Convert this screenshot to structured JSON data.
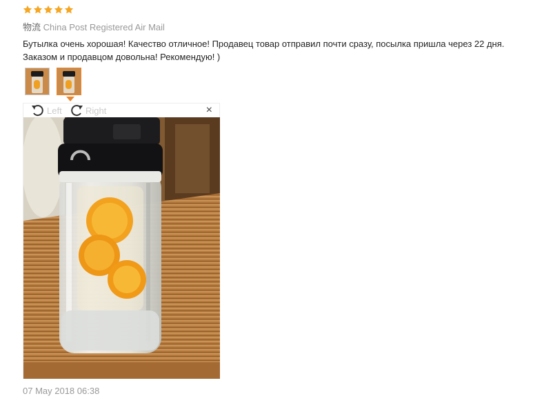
{
  "rating": {
    "stars": 5,
    "max": 5,
    "star_color": "#f5a623"
  },
  "logistics": {
    "label": "物流",
    "value": "China Post Registered Air Mail"
  },
  "review": {
    "text": "Бутылка очень хорошая! Качество отличное! Продавец товар отправил почти сразу, посылка пришла через 22 дня. Заказом и продавцом довольна! Рекомендую! )"
  },
  "thumbnails": [
    {
      "name": "thumb-1",
      "selected": false
    },
    {
      "name": "thumb-2",
      "selected": true
    }
  ],
  "viewer": {
    "rotate_left_label": "Left",
    "rotate_right_label": "Right",
    "close_glyph": "×",
    "icons": [
      "rotate-left-icon",
      "rotate-right-icon",
      "close-icon"
    ]
  },
  "date": "07 May 2018 06:38",
  "colors": {
    "accent": "#e8872f",
    "muted_text": "#999999",
    "toolbar_text": "#cccccc"
  }
}
